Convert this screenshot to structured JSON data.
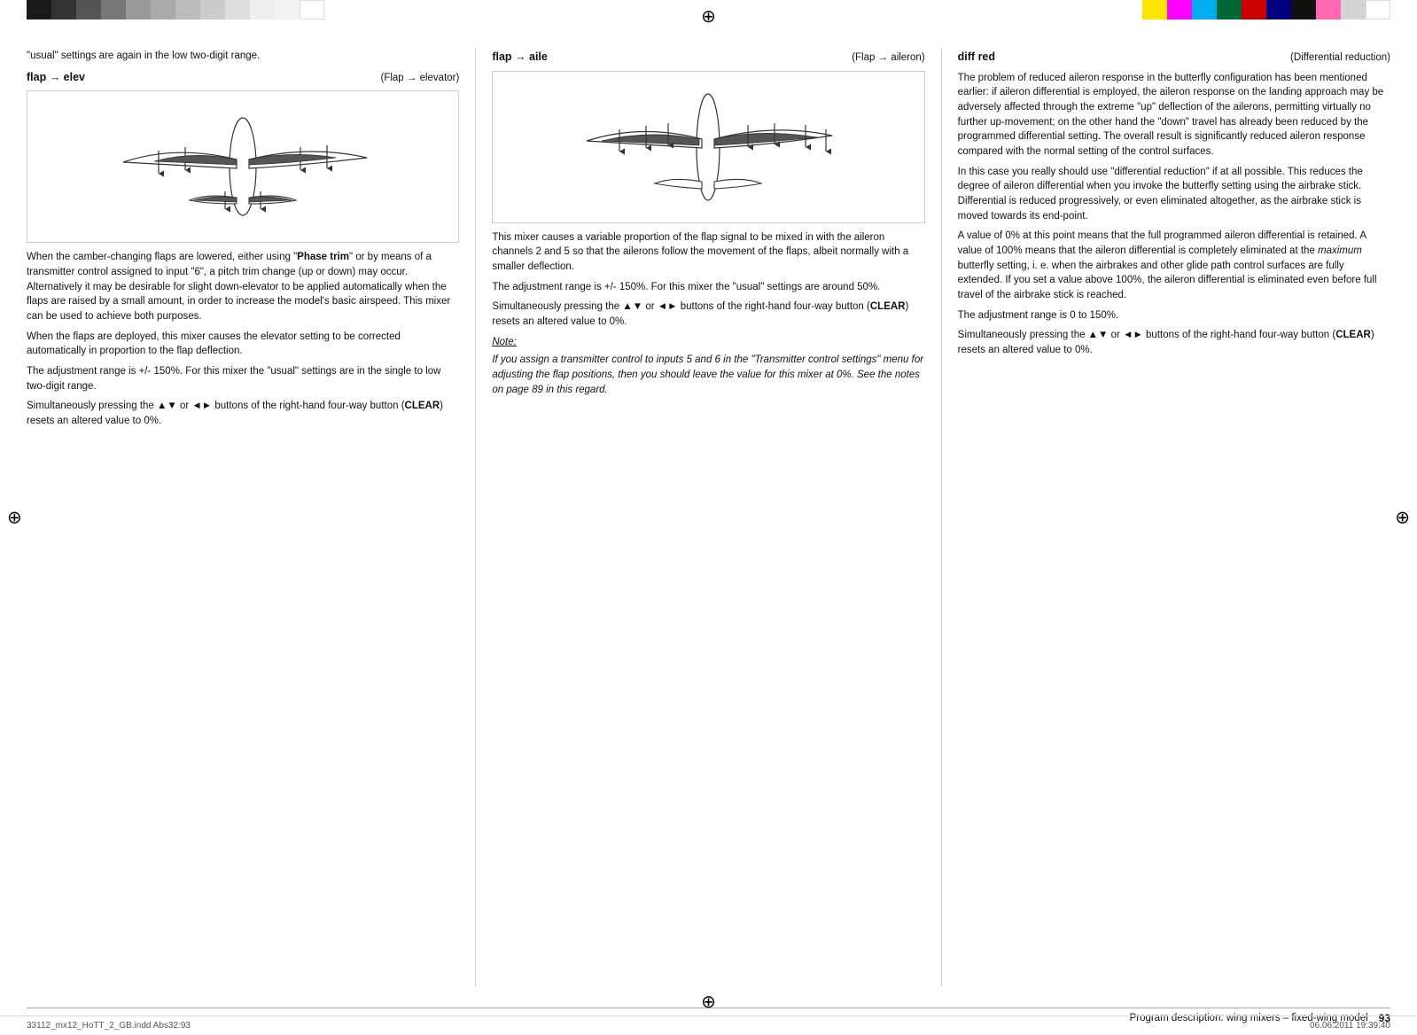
{
  "colors_left": [
    {
      "hex": "#1a1a1a"
    },
    {
      "hex": "#333"
    },
    {
      "hex": "#555"
    },
    {
      "hex": "#777"
    },
    {
      "hex": "#999"
    },
    {
      "hex": "#aaa"
    },
    {
      "hex": "#bbb"
    },
    {
      "hex": "#ccc"
    },
    {
      "hex": "#ddd"
    },
    {
      "hex": "#eee"
    },
    {
      "hex": "#f5f5f5"
    },
    {
      "hex": "#fff"
    }
  ],
  "colors_right": [
    {
      "hex": "#FFE600"
    },
    {
      "hex": "#FF00FF"
    },
    {
      "hex": "#00ADEF"
    },
    {
      "hex": "#006633"
    },
    {
      "hex": "#CC0000"
    },
    {
      "hex": "#000080"
    },
    {
      "hex": "#000000"
    },
    {
      "hex": "#FF69B4"
    },
    {
      "hex": "#D3D3D3"
    },
    {
      "hex": "#FFFFFF"
    }
  ],
  "col1": {
    "intro": "\"usual\" settings are again in the low two-digit range.",
    "header_title": "flap → elev",
    "header_subtitle": "(Flap → elevator)",
    "body1": "When the camber-changing flaps are lowered, either using \"Phase trim\" or by means of a transmitter control assigned to input \"6\", a pitch trim change (up or down) may occur. Alternatively it may be desirable for slight down-elevator to be applied automatically when the flaps are raised by a small amount, in order to increase the model's basic airspeed. This mixer can be used to achieve both purposes.",
    "body2": "When the flaps are deployed, this mixer causes the elevator setting to be corrected automatically in proportion to the flap deflection.",
    "body3": "The adjustment range is +/- 150%. For this mixer the \"usual\" settings are in the single to low two-digit range.",
    "body4": "Simultaneously pressing the ▲▼ or ◄► buttons of the right-hand four-way button (CLEAR) resets an altered value to 0%.",
    "clear_bold": "CLEAR"
  },
  "col2": {
    "header_title": "flap → aile",
    "header_subtitle": "(Flap → aileron)",
    "body1": "This mixer causes a variable proportion of the flap signal to be mixed in with the aileron channels 2 and 5 so that the ailerons follow the movement of the flaps, albeit normally with a smaller deflection.",
    "body2": "The adjustment range is +/- 150%. For this mixer the \"usual\" settings are around 50%.",
    "body3": "Simultaneously pressing the ▲▼ or ◄► buttons of the right-hand four-way button (CLEAR) resets an altered value to 0%.",
    "clear_bold": "CLEAR",
    "note_label": "Note:",
    "note_text": "If you assign a transmitter control to inputs 5 and 6 in the \"Transmitter control settings\" menu for adjusting the flap positions, then you should leave the value for this mixer at 0%. See the notes on page 89 in this regard."
  },
  "col3": {
    "header_title": "diff red",
    "header_subtitle": "(Differential reduction)",
    "body1": "The problem of reduced aileron response in the butterfly configuration has been mentioned earlier: if aileron differential is employed, the aileron response on the landing approach may be adversely affected through the extreme \"up\" deflection of the ailerons, permitting virtually no further up-movement; on the other hand the \"down\" travel has already been reduced by the programmed differential setting. The overall result is significantly reduced aileron response compared with the normal setting of the control surfaces.",
    "body2": "In this case you really should use \"differential reduction\" if at all possible. This reduces the degree of aileron differential when you invoke the butterfly setting using the airbrake stick. Differential is reduced progressively, or even eliminated altogether, as the airbrake stick is moved towards its end-point.",
    "body3": "A value of 0% at this point means that the full programmed aileron differential is retained. A value of 100% means that the aileron differential is completely eliminated at the maximum butterfly setting, i. e. when the airbrakes and other glide path control surfaces are fully extended. If you set a value above 100%, the aileron differential is eliminated even before full travel of the airbrake stick is reached.",
    "body3_italic": "maximum",
    "body4": "The adjustment range is 0 to 150%.",
    "body5": "Simultaneously pressing the ▲▼ or ◄► buttons of the right-hand four-way button (CLEAR) resets an altered value to 0%.",
    "clear_bold": "CLEAR"
  },
  "footer": {
    "text": "Program description: wing mixers – fixed-wing model",
    "page": "93"
  },
  "bottom_bar": {
    "left": "33112_mx12_HoTT_2_GB.indd   Abs32:93",
    "right": "06.06.2011   19:39:40"
  },
  "crosshair_char": "⊕",
  "or_text": "or"
}
